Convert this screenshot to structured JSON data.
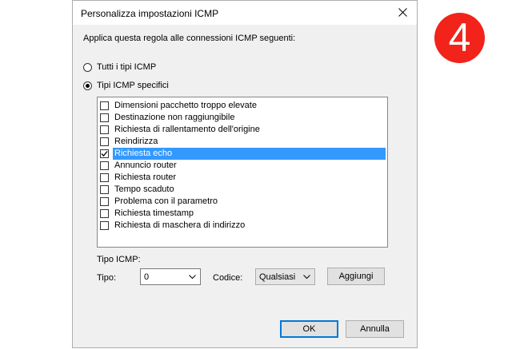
{
  "dialog": {
    "title": "Personalizza impostazioni ICMP",
    "intro": "Applica questa regola alle connessioni ICMP seguenti:",
    "radio_all_label": "Tutti i tipi ICMP",
    "radio_specific_label": "Tipi ICMP specifici",
    "selected_radio": "specific",
    "items": [
      {
        "label": "Dimensioni pacchetto troppo elevate",
        "checked": false
      },
      {
        "label": "Destinazione non raggiungibile",
        "checked": false
      },
      {
        "label": "Richiesta di rallentamento dell'origine",
        "checked": false
      },
      {
        "label": "Reindirizza",
        "checked": false
      },
      {
        "label": "Richiesta echo",
        "checked": true,
        "selected": true
      },
      {
        "label": "Annuncio router",
        "checked": false
      },
      {
        "label": "Richiesta router",
        "checked": false
      },
      {
        "label": "Tempo scaduto",
        "checked": false
      },
      {
        "label": "Problema con il parametro",
        "checked": false
      },
      {
        "label": "Richiesta timestamp",
        "checked": false
      },
      {
        "label": "Richiesta di maschera di indirizzo",
        "checked": false
      }
    ],
    "icmp_type_section": "Tipo ICMP:",
    "type_label": "Tipo:",
    "type_value": "0",
    "code_label": "Codice:",
    "code_value": "Qualsiasi",
    "add_button": "Aggiungi",
    "ok_button": "OK",
    "cancel_button": "Annulla"
  },
  "step_badge": {
    "number": "4",
    "color": "#f2231b"
  },
  "colors": {
    "selection": "#3399ff",
    "focus": "#0078d7",
    "dialog_bg": "#f0f0f0"
  }
}
